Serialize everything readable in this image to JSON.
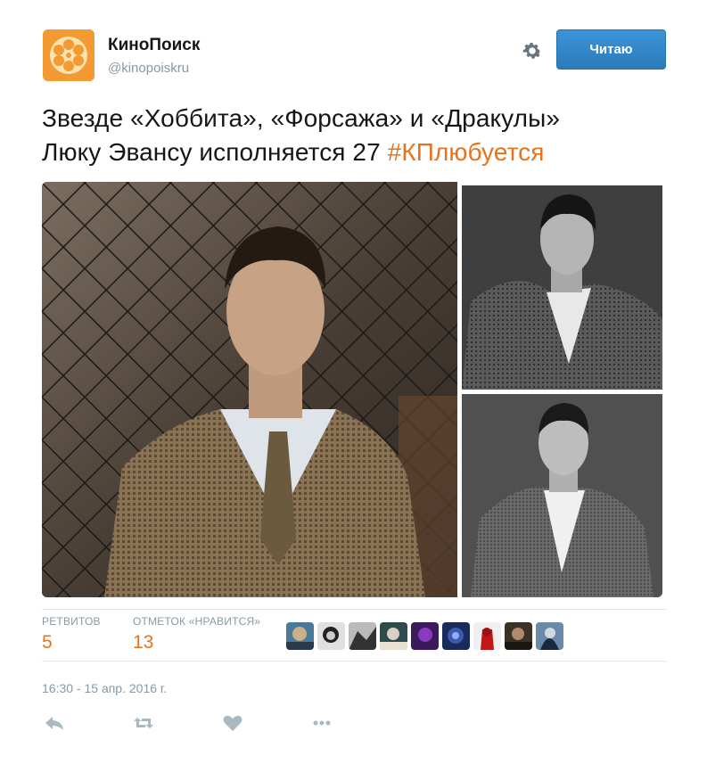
{
  "author": {
    "name": "КиноПоиск",
    "handle": "@kinopoiskru",
    "avatar_color": "#f39a33"
  },
  "follow_button": {
    "label": "Читаю",
    "color": "#2b7bb9"
  },
  "tweet": {
    "text_line1": "Звезде «Хоббита», «Форсажа» и «Дракулы»",
    "text_line2": "Люку Эвансу исполняется 27 ",
    "hashtag": "#КПлюбуется",
    "hashtag_color": "#e8731a"
  },
  "stats": {
    "retweets_label": "РЕТВИТОВ",
    "retweets_count": "5",
    "likes_label": "ОТМЕТОК «НРАВИТСЯ»",
    "likes_count": "13"
  },
  "liker_count": 9,
  "timestamp": "16:30 - 15 апр. 2016 г.",
  "icons": [
    "gear-icon",
    "reply-icon",
    "retweet-icon",
    "like-icon",
    "more-icon"
  ]
}
